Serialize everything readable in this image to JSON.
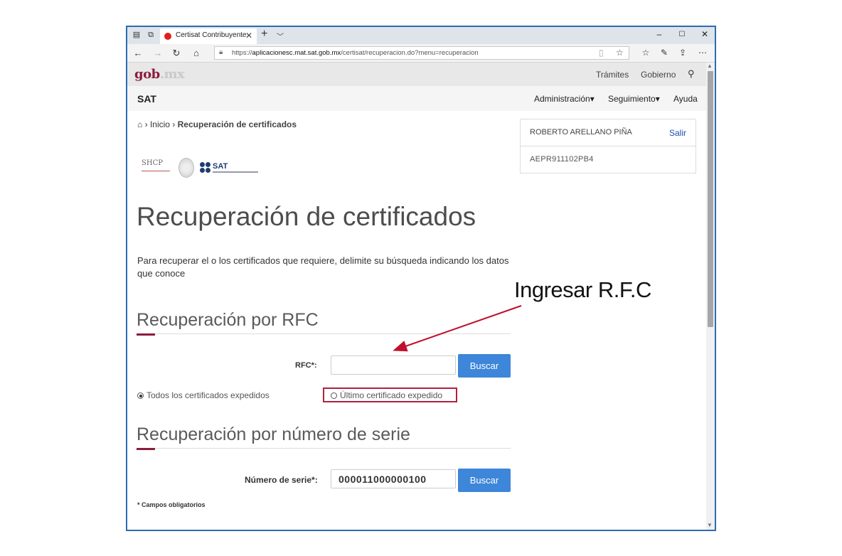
{
  "browser": {
    "tab_title": "Certisat Contribuyente",
    "new_tab": "+",
    "url_prefix": "https://",
    "url_host": "aplicacionesc.mat.sat.gob.mx",
    "url_path": "/certisat/recuperacion.do?menu=recuperacion",
    "window_controls": {
      "minimize": "–",
      "maximize": "☐",
      "close": "✕"
    }
  },
  "gob_bar": {
    "logo_main": "gob",
    "logo_suffix": ".mx",
    "links": [
      "Trámites",
      "Gobierno"
    ]
  },
  "sat_bar": {
    "title": "SAT",
    "menu": [
      "Administración▾",
      "Seguimiento▾",
      "Ayuda"
    ]
  },
  "breadcrumb": {
    "home": "Inicio",
    "current": "Recuperación de certificados"
  },
  "logos": {
    "shcp": "SHCP",
    "sat": "SAT"
  },
  "user": {
    "name": "ROBERTO ARELLANO PIÑA",
    "exit": "Salir",
    "rfc": "AEPR911102PB4"
  },
  "page": {
    "title": "Recuperación de certificados",
    "intro": "Para recuperar el o los certificados que requiere, delimite su búsqueda indicando los datos que conoce"
  },
  "rfc_section": {
    "title": "Recuperación por RFC",
    "field_label": "RFC*:",
    "field_value": "",
    "button": "Buscar",
    "option_all": "Todos los certificados expedidos",
    "option_last": "Último certificado expedido"
  },
  "serial_section": {
    "title": "Recuperación por número de serie",
    "field_label": "Número de serie*:",
    "field_value": "000011000000100",
    "button": "Buscar",
    "required_note": "* Campos obligatorios"
  },
  "annotation": {
    "text": "Ingresar R.F.C",
    "color": "#c0102e"
  }
}
